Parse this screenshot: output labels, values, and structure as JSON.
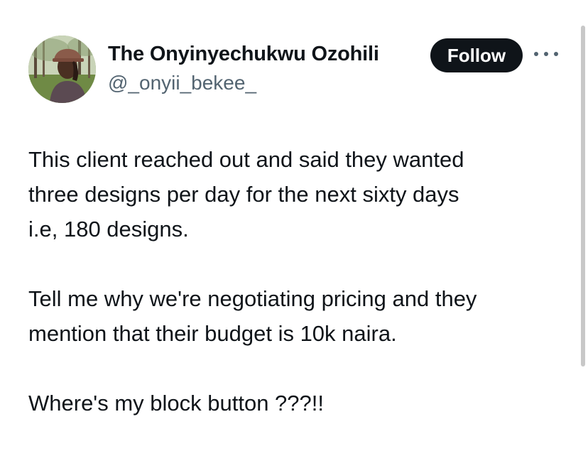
{
  "user": {
    "display_name": "The Onyinyechukwu Ozohili",
    "handle": "@_onyii_bekee_"
  },
  "actions": {
    "follow_label": "Follow",
    "more_icon": "more-horizontal-icon"
  },
  "tweet": {
    "paragraphs": [
      "This client reached out and said they wanted\nthree designs per day for the next sixty days\ni.e, 180 designs.",
      "Tell me why we're negotiating pricing and they\nmention that their budget is 10k naira.",
      "Where's my block button ???!!"
    ]
  },
  "colors": {
    "text": "#0f1419",
    "secondary": "#536471",
    "button_bg": "#0f1419",
    "button_text": "#ffffff"
  }
}
